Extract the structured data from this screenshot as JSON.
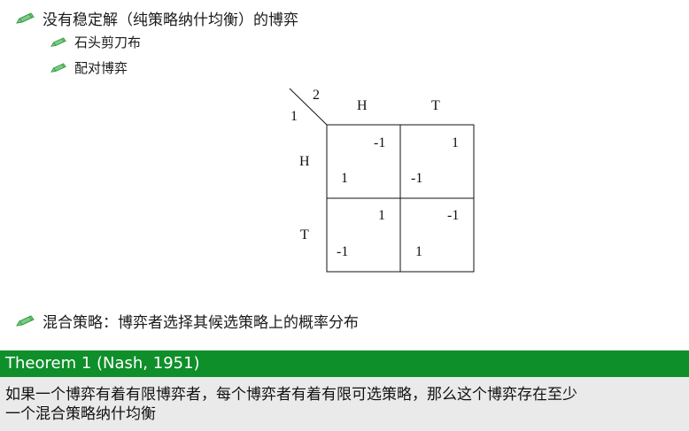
{
  "bullets": {
    "b1": "没有稳定解（纯策略纳什均衡）的博弈",
    "b1_sub": [
      "石头剪刀布",
      "配对博弈"
    ],
    "b2": "混合策略：博弈者选择其候选策略上的概率分布"
  },
  "game": {
    "corner_player_top": "2",
    "corner_player_left": "1",
    "col_labels": [
      "H",
      "T"
    ],
    "row_labels": [
      "H",
      "T"
    ],
    "cells": [
      [
        {
          "top": "-1",
          "bottom": "1"
        },
        {
          "top": "1",
          "bottom": "-1"
        }
      ],
      [
        {
          "top": "1",
          "bottom": "-1"
        },
        {
          "top": "-1",
          "bottom": "1"
        }
      ]
    ]
  },
  "theorem": {
    "title": "Theorem 1 (Nash, 1951)",
    "body_line1": "如果一个博弈有着有限博弈者，每个博弈者有着有限可选策略，那么这个博弈存在至少",
    "body_line2": "一个混合策略纳什均衡"
  },
  "colors": {
    "theorem_header": "#0f8f2a",
    "theorem_body": "#eaeaea",
    "bullet_icon": "#2e9e3a"
  },
  "icons": {
    "bullet": "pencil-icon"
  }
}
